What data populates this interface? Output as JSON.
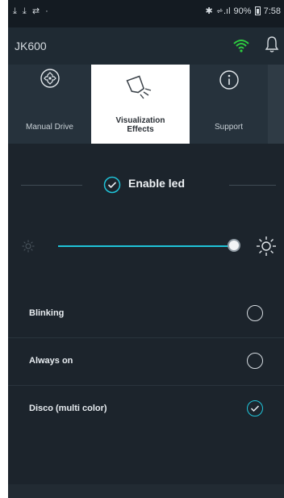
{
  "status_bar": {
    "left_icons": "⤓ ⤓ ⇄ ·",
    "bluetooth": "✱",
    "signal": "⩫.ıl",
    "battery_percent": "90%",
    "time": "7:58"
  },
  "header": {
    "title": "JK600",
    "wifi_color": "#2ecc40"
  },
  "tabs": [
    {
      "label": "Manual Drive",
      "icon": "gamepad-icon",
      "active": false
    },
    {
      "label": "Visualization Effects",
      "icon": "spotlight-icon",
      "active": true
    },
    {
      "label": "Support",
      "icon": "info-icon",
      "active": false
    }
  ],
  "enable_led": {
    "label": "Enable led",
    "checked": true
  },
  "brightness": {
    "level": 0.98,
    "accent": "#1fc3d8"
  },
  "options": [
    {
      "label": "Blinking",
      "selected": false
    },
    {
      "label": "Always on",
      "selected": false
    },
    {
      "label": "Disco (multi color)",
      "selected": true
    }
  ]
}
